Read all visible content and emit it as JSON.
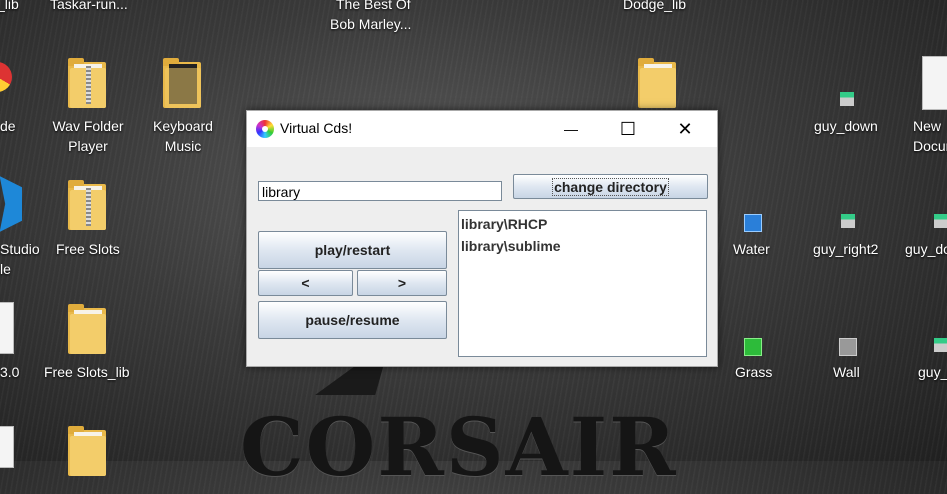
{
  "desktop": {
    "top_labels": [
      "z_lib",
      "Taskar-run...",
      "The Best Of",
      "Bob Marley...",
      "Dodge_lib"
    ],
    "icons": [
      {
        "label": "de"
      },
      {
        "label": "Wav Folder Player"
      },
      {
        "label": "Keyboard Music"
      },
      {
        "label": "guy_down"
      },
      {
        "label": "New Docum..."
      },
      {
        "label": "Studio"
      },
      {
        "label": "le"
      },
      {
        "label": "Free Slots"
      },
      {
        "label": "Water"
      },
      {
        "label": "guy_right2"
      },
      {
        "label": "guy_do..."
      },
      {
        "label": "3.0"
      },
      {
        "label": "Free Slots_lib"
      },
      {
        "label": "Grass"
      },
      {
        "label": "Wall"
      },
      {
        "label": "guy_..."
      }
    ],
    "wallpaper_text": "CORSAIR"
  },
  "window": {
    "title": "Virtual Cds!",
    "minimize_glyph": "—",
    "maximize_glyph": "☐",
    "close_glyph": "✕",
    "directory_field_value": "library",
    "change_directory_label": "change directory",
    "play_label": "play/restart",
    "prev_label": "<",
    "next_label": ">",
    "pause_label": "pause/resume",
    "list_items": [
      "library\\RHCP",
      "library\\sublime"
    ]
  }
}
